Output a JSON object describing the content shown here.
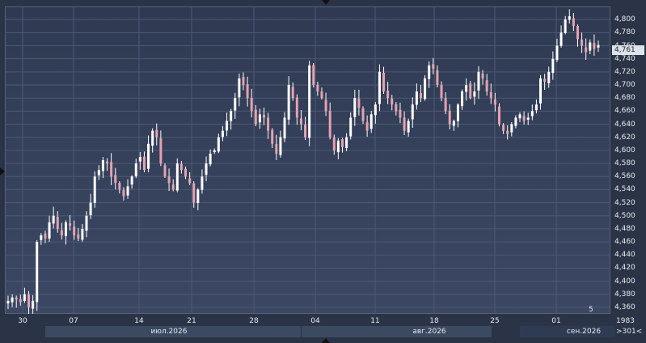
{
  "chart_data": {
    "type": "candlestick",
    "y_ticks": [
      "4,800",
      "4,780",
      "4,760",
      "4,740",
      "4,720",
      "4,700",
      "4,680",
      "4,660",
      "4,640",
      "4,620",
      "4,600",
      "4,580",
      "4,560",
      "4,540",
      "4,520",
      "4,500",
      "4,480",
      "4,460",
      "4,440",
      "4,420",
      "4,400",
      "4,380",
      "4,360"
    ],
    "ylim": [
      4.35,
      4.82
    ],
    "x_ticks": [
      "30",
      "07",
      "14",
      "21",
      "28",
      "04",
      "11",
      "18",
      "25",
      "01"
    ],
    "months": [
      "июл.2026",
      "авг.2026",
      "сен.2026"
    ],
    "current_price": "4,761",
    "bottom_right_top": "1983",
    "bottom_right_bottom": ">301<",
    "small_label": "5",
    "colors": {
      "up": "#ffffff",
      "down": "#e8a0b0",
      "wick": "#ffffff",
      "background_top": "#2f3a52",
      "background_bottom": "#3c4763"
    },
    "close_path": [
      4.37,
      4.375,
      4.372,
      4.368,
      4.38,
      4.36,
      4.37,
      4.46,
      4.47,
      4.465,
      4.49,
      4.5,
      4.48,
      4.47,
      4.49,
      4.485,
      4.47,
      4.465,
      4.48,
      4.5,
      4.52,
      4.56,
      4.57,
      4.585,
      4.58,
      4.56,
      4.55,
      4.54,
      4.53,
      4.545,
      4.56,
      4.58,
      4.59,
      4.57,
      4.61,
      4.63,
      4.62,
      4.58,
      4.56,
      4.55,
      4.54,
      4.58,
      4.57,
      4.56,
      4.55,
      4.52,
      4.54,
      4.56,
      4.58,
      4.595,
      4.6,
      4.62,
      4.63,
      4.645,
      4.66,
      4.68,
      4.71,
      4.7,
      4.68,
      4.66,
      4.64,
      4.655,
      4.65,
      4.63,
      4.61,
      4.595,
      4.62,
      4.65,
      4.7,
      4.68,
      4.65,
      4.64,
      4.62,
      4.73,
      4.7,
      4.69,
      4.68,
      4.66,
      4.62,
      4.6,
      4.615,
      4.605,
      4.62,
      4.65,
      4.68,
      4.665,
      4.645,
      4.63,
      4.655,
      4.67,
      4.72,
      4.69,
      4.68,
      4.67,
      4.66,
      4.65,
      4.63,
      4.645,
      4.67,
      4.69,
      4.68,
      4.71,
      4.73,
      4.725,
      4.7,
      4.68,
      4.66,
      4.64,
      4.645,
      4.67,
      4.69,
      4.7,
      4.68,
      4.69,
      4.72,
      4.71,
      4.69,
      4.68,
      4.67,
      4.64,
      4.63,
      4.625,
      4.64,
      4.65,
      4.655,
      4.645,
      4.65,
      4.66,
      4.67,
      4.71,
      4.705,
      4.72,
      4.74,
      4.76,
      4.78,
      4.8,
      4.805,
      4.79,
      4.77,
      4.76,
      4.75,
      4.765,
      4.755,
      4.761
    ]
  }
}
